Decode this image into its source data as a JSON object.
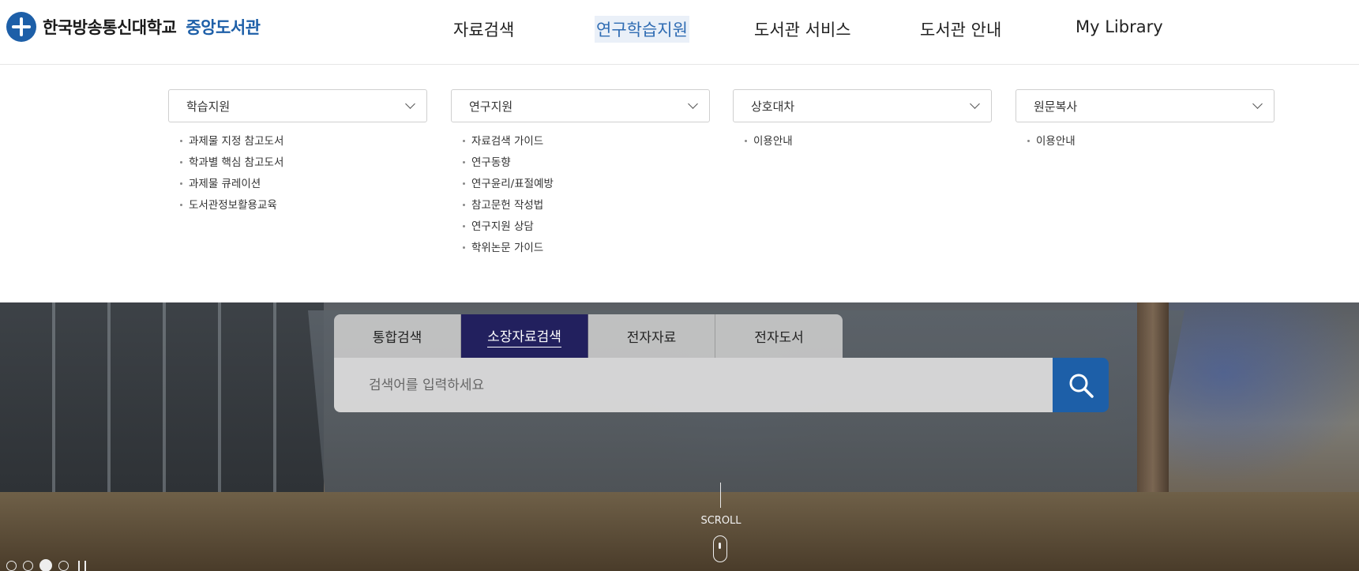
{
  "header": {
    "logo_univ": "한국방송통신대학교",
    "logo_lib": "중앙도서관",
    "nav": [
      {
        "label": "자료검색"
      },
      {
        "label": "연구학습지원",
        "active": true
      },
      {
        "label": "도서관 서비스"
      },
      {
        "label": "도서관 안내"
      },
      {
        "label": "My Library"
      }
    ]
  },
  "mega_menu": {
    "columns": [
      {
        "title": "학습지원",
        "items": [
          "과제물 지정 참고도서",
          "학과별 핵심 참고도서",
          "과제물 큐레이션",
          "도서관정보활용교육"
        ]
      },
      {
        "title": "연구지원",
        "items": [
          "자료검색 가이드",
          "연구동향",
          "연구윤리/표절예방",
          "참고문헌 작성법",
          "연구지원 상담",
          "학위논문 가이드"
        ]
      },
      {
        "title": "상호대차",
        "items": [
          "이용안내"
        ]
      },
      {
        "title": "원문복사",
        "items": [
          "이용안내"
        ]
      }
    ]
  },
  "search": {
    "tabs": [
      {
        "label": "통합검색"
      },
      {
        "label": "소장자료검색",
        "active": true
      },
      {
        "label": "전자자료"
      },
      {
        "label": "전자도서"
      }
    ],
    "placeholder": "검색어를 입력하세요",
    "button_icon": "search-icon"
  },
  "hero": {
    "scroll_label": "SCROLL",
    "slides": 4,
    "current_slide": 3
  },
  "colors": {
    "brand": "#1d5fa8",
    "active_tab": "#22205e",
    "nav_active": "#2f6cb3"
  }
}
